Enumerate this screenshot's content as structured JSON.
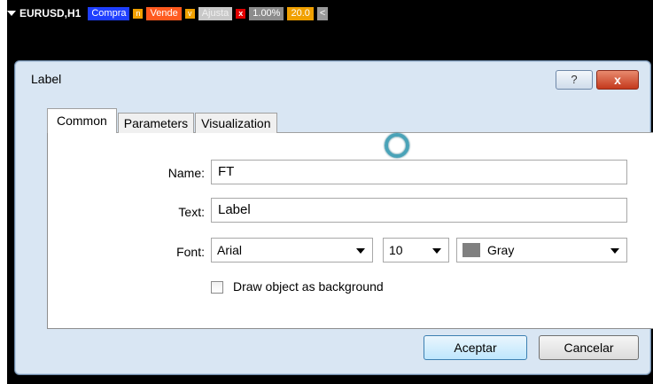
{
  "toolbar": {
    "symbol": "EURUSD,H1",
    "buy_label": "Compra",
    "buy_tag": "n",
    "sell_label": "Vende",
    "sell_tag": "v",
    "adjust_label": "Ajusta",
    "close_tag": "x",
    "risk_pct": "1.00%",
    "lots": "20.0",
    "collapse": "<"
  },
  "dialog": {
    "title": "Label",
    "help": "?",
    "close": "x",
    "tabs": [
      "Common",
      "Parameters",
      "Visualization"
    ],
    "fields": {
      "name_label": "Name:",
      "name_value": "FT",
      "text_label": "Text:",
      "text_value": "Label",
      "font_label": "Font:",
      "font_value": "Arial",
      "size_value": "10",
      "color_value": "Gray",
      "color_hex": "#808080",
      "background_label": "Draw object as background"
    },
    "buttons": {
      "ok": "Aceptar",
      "cancel": "Cancelar"
    }
  }
}
